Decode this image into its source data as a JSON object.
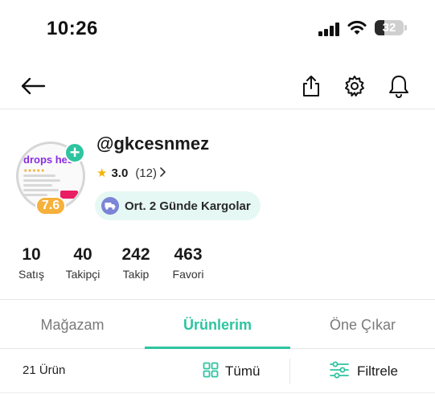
{
  "status_bar": {
    "time": "10:26",
    "battery_level": "32",
    "icons": [
      "signal-icon",
      "wifi-icon",
      "battery-icon"
    ]
  },
  "nav": {
    "icons": [
      "back-arrow-icon",
      "share-icon",
      "gear-icon",
      "bell-icon"
    ]
  },
  "profile": {
    "username": "@gkcesnmez",
    "rating": "3.0",
    "rating_count": "(12)",
    "seller_score": "7.6",
    "avatar_brand_text": "drops hes",
    "cargo_badge": "Ort. 2 Günde Kargolar",
    "stats": [
      {
        "value": "10",
        "label": "Satış"
      },
      {
        "value": "40",
        "label": "Takipçi"
      },
      {
        "value": "242",
        "label": "Takip"
      },
      {
        "value": "463",
        "label": "Favori"
      }
    ]
  },
  "tabs": [
    {
      "label": "Mağazam",
      "active": false
    },
    {
      "label": "Ürünlerim",
      "active": true
    },
    {
      "label": "Öne Çıkar",
      "active": false
    }
  ],
  "filters": {
    "product_count": "21 Ürün",
    "all_label": "Tümü",
    "filter_label": "Filtrele"
  },
  "colors": {
    "accent": "#2ec4a0",
    "score_badge": "#f6b13c",
    "cargo_pill_bg": "#e6f8f4",
    "star": "#f5b301"
  }
}
